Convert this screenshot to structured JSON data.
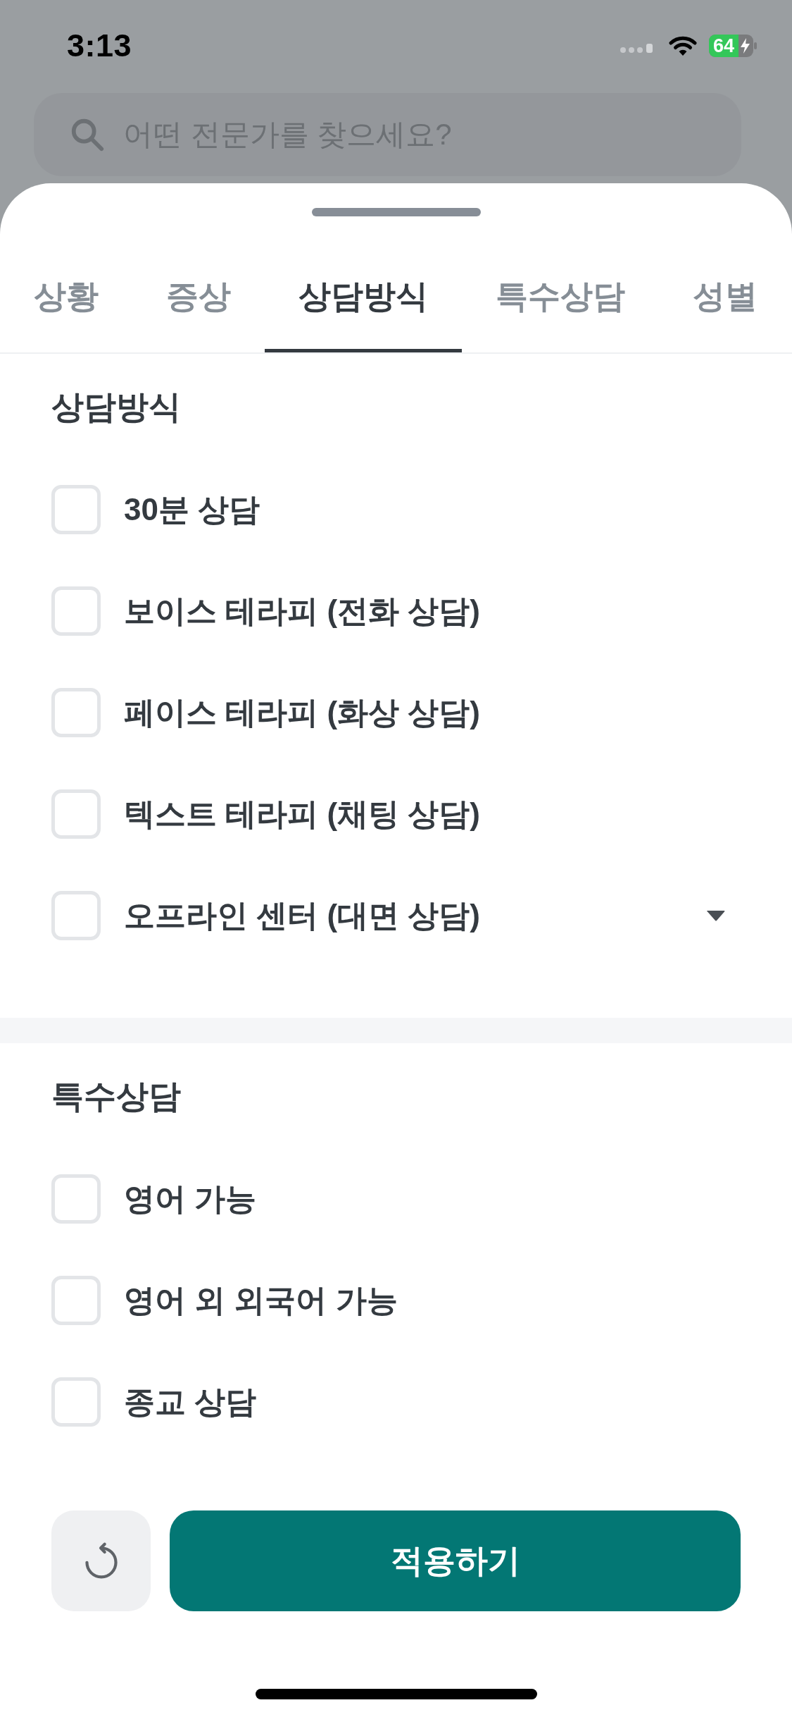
{
  "status_bar": {
    "time": "3:13",
    "battery": "64"
  },
  "search": {
    "placeholder": "어떤 전문가를 찾으세요?"
  },
  "sheet": {
    "tabs": [
      {
        "label": "상황",
        "selected": false
      },
      {
        "label": "증상",
        "selected": false
      },
      {
        "label": "상담방식",
        "selected": true
      },
      {
        "label": "특수상담",
        "selected": false
      },
      {
        "label": "성별",
        "selected": false
      }
    ],
    "sections": [
      {
        "title": "상담방식",
        "options": [
          {
            "kind": "checkbox",
            "label": "30분 상담",
            "checked": false
          },
          {
            "kind": "checkbox",
            "label": "보이스 테라피 (전화 상담)",
            "checked": false
          },
          {
            "kind": "checkbox",
            "label": "페이스 테라피 (화상 상담)",
            "checked": false
          },
          {
            "kind": "checkbox",
            "label": "텍스트 테라피 (채팅 상담)",
            "checked": false
          },
          {
            "kind": "expandable",
            "label": "오프라인 센터 (대면 상담)",
            "checked": false,
            "expanded": false
          }
        ]
      },
      {
        "title": "특수상담",
        "options": [
          {
            "kind": "checkbox",
            "label": "영어 가능",
            "checked": false
          },
          {
            "kind": "checkbox",
            "label": "영어 외 외국어 가능",
            "checked": false
          },
          {
            "kind": "checkbox",
            "label": "종교 상담",
            "checked": false
          }
        ]
      }
    ],
    "apply_button": {
      "label": "적용하기"
    }
  }
}
